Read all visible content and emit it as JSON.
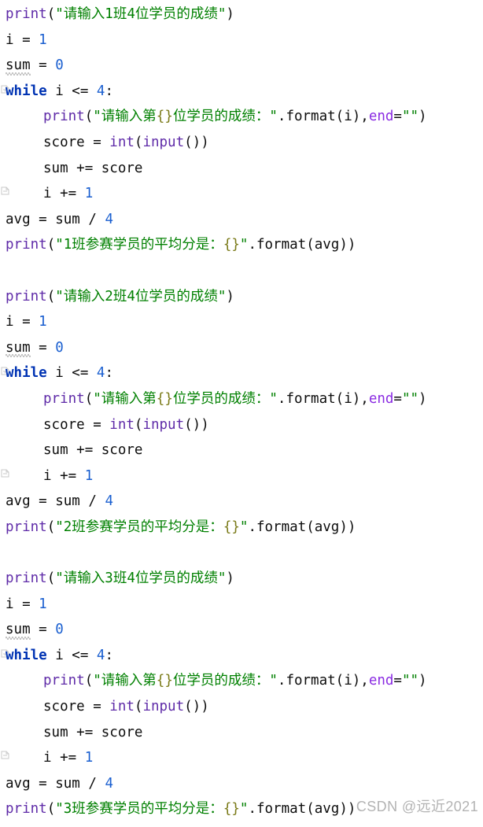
{
  "editor": {
    "language": "Python",
    "colors": {
      "background": "#ffffff",
      "text": "#0d0d0d",
      "keyword": "#0033b3",
      "builtin_function": "#5f2ba8",
      "number": "#1a5fd0",
      "string": "#008000",
      "format_brace": "#7a7a18",
      "keyword_argument": "#8a2be2",
      "warning_squiggle": "#b9b9b9",
      "fold_marker": "#c8c8c8"
    },
    "lines": [
      {
        "n": 1,
        "indent": 0,
        "tokens": [
          {
            "t": "print",
            "c": "fn"
          },
          {
            "t": "(",
            "c": "punct"
          },
          {
            "t": "\"请输入",
            "c": "str"
          },
          {
            "t": "1班4位学员的成绩\"",
            "c": "str"
          },
          {
            "t": ")",
            "c": "punct"
          }
        ]
      },
      {
        "n": 2,
        "indent": 0,
        "tokens": [
          {
            "t": "i ",
            "c": "plain"
          },
          {
            "t": "= ",
            "c": "punct"
          },
          {
            "t": "1",
            "c": "num"
          }
        ]
      },
      {
        "n": 3,
        "indent": 0,
        "warn": "sum",
        "tokens": [
          {
            "t": "sum",
            "c": "warn"
          },
          {
            "t": " = ",
            "c": "punct"
          },
          {
            "t": "0",
            "c": "num"
          }
        ]
      },
      {
        "n": 4,
        "indent": 0,
        "fold": "start",
        "tokens": [
          {
            "t": "while",
            "c": "kw"
          },
          {
            "t": " i ",
            "c": "plain"
          },
          {
            "t": "<=",
            "c": "punct"
          },
          {
            "t": " ",
            "c": "plain"
          },
          {
            "t": "4",
            "c": "num"
          },
          {
            "t": ":",
            "c": "punct"
          }
        ]
      },
      {
        "n": 5,
        "indent": 1,
        "tokens": [
          {
            "t": "print",
            "c": "fn"
          },
          {
            "t": "(",
            "c": "punct"
          },
          {
            "t": "\"请输入第",
            "c": "str"
          },
          {
            "t": "{}",
            "c": "brace"
          },
          {
            "t": "位学员的成绩：\"",
            "c": "str"
          },
          {
            "t": ".format(i)",
            "c": "plain"
          },
          {
            "t": ",",
            "c": "punct"
          },
          {
            "t": "end",
            "c": "kwarg"
          },
          {
            "t": "=",
            "c": "punct"
          },
          {
            "t": "\"\"",
            "c": "str"
          },
          {
            "t": ")",
            "c": "punct"
          }
        ]
      },
      {
        "n": 6,
        "indent": 1,
        "tokens": [
          {
            "t": "score ",
            "c": "plain"
          },
          {
            "t": "= ",
            "c": "punct"
          },
          {
            "t": "int",
            "c": "fn"
          },
          {
            "t": "(",
            "c": "punct"
          },
          {
            "t": "input",
            "c": "fn"
          },
          {
            "t": "())",
            "c": "punct"
          }
        ]
      },
      {
        "n": 7,
        "indent": 1,
        "tokens": [
          {
            "t": "sum ",
            "c": "plain"
          },
          {
            "t": "+= ",
            "c": "punct"
          },
          {
            "t": "score",
            "c": "plain"
          }
        ]
      },
      {
        "n": 8,
        "indent": 1,
        "fold": "end",
        "tokens": [
          {
            "t": "i ",
            "c": "plain"
          },
          {
            "t": "+= ",
            "c": "punct"
          },
          {
            "t": "1",
            "c": "num"
          }
        ]
      },
      {
        "n": 9,
        "indent": 0,
        "tokens": [
          {
            "t": "avg ",
            "c": "plain"
          },
          {
            "t": "= ",
            "c": "punct"
          },
          {
            "t": "sum ",
            "c": "plain"
          },
          {
            "t": "/ ",
            "c": "punct"
          },
          {
            "t": "4",
            "c": "num"
          }
        ]
      },
      {
        "n": 10,
        "indent": 0,
        "tokens": [
          {
            "t": "print",
            "c": "fn"
          },
          {
            "t": "(",
            "c": "punct"
          },
          {
            "t": "\"1班参赛学员的平均分是：",
            "c": "str"
          },
          {
            "t": "{}",
            "c": "brace"
          },
          {
            "t": "\"",
            "c": "str"
          },
          {
            "t": ".format(avg)",
            "c": "plain"
          },
          {
            "t": ")",
            "c": "punct"
          }
        ]
      },
      {
        "n": 11,
        "indent": 0,
        "blank": true,
        "tokens": []
      },
      {
        "n": 12,
        "indent": 0,
        "tokens": [
          {
            "t": "print",
            "c": "fn"
          },
          {
            "t": "(",
            "c": "punct"
          },
          {
            "t": "\"请输入",
            "c": "str"
          },
          {
            "t": "2班4位学员的成绩\"",
            "c": "str"
          },
          {
            "t": ")",
            "c": "punct"
          }
        ]
      },
      {
        "n": 13,
        "indent": 0,
        "tokens": [
          {
            "t": "i ",
            "c": "plain"
          },
          {
            "t": "= ",
            "c": "punct"
          },
          {
            "t": "1",
            "c": "num"
          }
        ]
      },
      {
        "n": 14,
        "indent": 0,
        "warn": "sum",
        "tokens": [
          {
            "t": "sum",
            "c": "warn"
          },
          {
            "t": " = ",
            "c": "punct"
          },
          {
            "t": "0",
            "c": "num"
          }
        ]
      },
      {
        "n": 15,
        "indent": 0,
        "fold": "start",
        "tokens": [
          {
            "t": "while",
            "c": "kw"
          },
          {
            "t": " i ",
            "c": "plain"
          },
          {
            "t": "<=",
            "c": "punct"
          },
          {
            "t": " ",
            "c": "plain"
          },
          {
            "t": "4",
            "c": "num"
          },
          {
            "t": ":",
            "c": "punct"
          }
        ]
      },
      {
        "n": 16,
        "indent": 1,
        "tokens": [
          {
            "t": "print",
            "c": "fn"
          },
          {
            "t": "(",
            "c": "punct"
          },
          {
            "t": "\"请输入第",
            "c": "str"
          },
          {
            "t": "{}",
            "c": "brace"
          },
          {
            "t": "位学员的成绩：\"",
            "c": "str"
          },
          {
            "t": ".format(i)",
            "c": "plain"
          },
          {
            "t": ",",
            "c": "punct"
          },
          {
            "t": "end",
            "c": "kwarg"
          },
          {
            "t": "=",
            "c": "punct"
          },
          {
            "t": "\"\"",
            "c": "str"
          },
          {
            "t": ")",
            "c": "punct"
          }
        ]
      },
      {
        "n": 17,
        "indent": 1,
        "tokens": [
          {
            "t": "score ",
            "c": "plain"
          },
          {
            "t": "= ",
            "c": "punct"
          },
          {
            "t": "int",
            "c": "fn"
          },
          {
            "t": "(",
            "c": "punct"
          },
          {
            "t": "input",
            "c": "fn"
          },
          {
            "t": "())",
            "c": "punct"
          }
        ]
      },
      {
        "n": 18,
        "indent": 1,
        "tokens": [
          {
            "t": "sum ",
            "c": "plain"
          },
          {
            "t": "+= ",
            "c": "punct"
          },
          {
            "t": "score",
            "c": "plain"
          }
        ]
      },
      {
        "n": 19,
        "indent": 1,
        "fold": "end",
        "tokens": [
          {
            "t": "i ",
            "c": "plain"
          },
          {
            "t": "+= ",
            "c": "punct"
          },
          {
            "t": "1",
            "c": "num"
          }
        ]
      },
      {
        "n": 20,
        "indent": 0,
        "tokens": [
          {
            "t": "avg ",
            "c": "plain"
          },
          {
            "t": "= ",
            "c": "punct"
          },
          {
            "t": "sum ",
            "c": "plain"
          },
          {
            "t": "/ ",
            "c": "punct"
          },
          {
            "t": "4",
            "c": "num"
          }
        ]
      },
      {
        "n": 21,
        "indent": 0,
        "tokens": [
          {
            "t": "print",
            "c": "fn"
          },
          {
            "t": "(",
            "c": "punct"
          },
          {
            "t": "\"2班参赛学员的平均分是：",
            "c": "str"
          },
          {
            "t": "{}",
            "c": "brace"
          },
          {
            "t": "\"",
            "c": "str"
          },
          {
            "t": ".format(avg)",
            "c": "plain"
          },
          {
            "t": ")",
            "c": "punct"
          }
        ]
      },
      {
        "n": 22,
        "indent": 0,
        "blank": true,
        "tokens": []
      },
      {
        "n": 23,
        "indent": 0,
        "tokens": [
          {
            "t": "print",
            "c": "fn"
          },
          {
            "t": "(",
            "c": "punct"
          },
          {
            "t": "\"请输入",
            "c": "str"
          },
          {
            "t": "3班4位学员的成绩\"",
            "c": "str"
          },
          {
            "t": ")",
            "c": "punct"
          }
        ]
      },
      {
        "n": 24,
        "indent": 0,
        "tokens": [
          {
            "t": "i ",
            "c": "plain"
          },
          {
            "t": "= ",
            "c": "punct"
          },
          {
            "t": "1",
            "c": "num"
          }
        ]
      },
      {
        "n": 25,
        "indent": 0,
        "warn": "sum",
        "tokens": [
          {
            "t": "sum",
            "c": "warn"
          },
          {
            "t": " = ",
            "c": "punct"
          },
          {
            "t": "0",
            "c": "num"
          }
        ]
      },
      {
        "n": 26,
        "indent": 0,
        "fold": "start",
        "tokens": [
          {
            "t": "while",
            "c": "kw"
          },
          {
            "t": " i ",
            "c": "plain"
          },
          {
            "t": "<=",
            "c": "punct"
          },
          {
            "t": " ",
            "c": "plain"
          },
          {
            "t": "4",
            "c": "num"
          },
          {
            "t": ":",
            "c": "punct"
          }
        ]
      },
      {
        "n": 27,
        "indent": 1,
        "tokens": [
          {
            "t": "print",
            "c": "fn"
          },
          {
            "t": "(",
            "c": "punct"
          },
          {
            "t": "\"请输入第",
            "c": "str"
          },
          {
            "t": "{}",
            "c": "brace"
          },
          {
            "t": "位学员的成绩：\"",
            "c": "str"
          },
          {
            "t": ".format(i)",
            "c": "plain"
          },
          {
            "t": ",",
            "c": "punct"
          },
          {
            "t": "end",
            "c": "kwarg"
          },
          {
            "t": "=",
            "c": "punct"
          },
          {
            "t": "\"\"",
            "c": "str"
          },
          {
            "t": ")",
            "c": "punct"
          }
        ]
      },
      {
        "n": 28,
        "indent": 1,
        "tokens": [
          {
            "t": "score ",
            "c": "plain"
          },
          {
            "t": "= ",
            "c": "punct"
          },
          {
            "t": "int",
            "c": "fn"
          },
          {
            "t": "(",
            "c": "punct"
          },
          {
            "t": "input",
            "c": "fn"
          },
          {
            "t": "())",
            "c": "punct"
          }
        ]
      },
      {
        "n": 29,
        "indent": 1,
        "tokens": [
          {
            "t": "sum ",
            "c": "plain"
          },
          {
            "t": "+= ",
            "c": "punct"
          },
          {
            "t": "score",
            "c": "plain"
          }
        ]
      },
      {
        "n": 30,
        "indent": 1,
        "fold": "end",
        "tokens": [
          {
            "t": "i ",
            "c": "plain"
          },
          {
            "t": "+= ",
            "c": "punct"
          },
          {
            "t": "1",
            "c": "num"
          }
        ]
      },
      {
        "n": 31,
        "indent": 0,
        "tokens": [
          {
            "t": "avg ",
            "c": "plain"
          },
          {
            "t": "= ",
            "c": "punct"
          },
          {
            "t": "sum ",
            "c": "plain"
          },
          {
            "t": "/ ",
            "c": "punct"
          },
          {
            "t": "4",
            "c": "num"
          }
        ]
      },
      {
        "n": 32,
        "indent": 0,
        "clipped": true,
        "tokens": [
          {
            "t": "print",
            "c": "fn"
          },
          {
            "t": "(",
            "c": "punct"
          },
          {
            "t": "\"3班参赛学员的平均分是：",
            "c": "str"
          },
          {
            "t": "{}",
            "c": "brace"
          },
          {
            "t": "\"",
            "c": "str"
          },
          {
            "t": ".format(avg)",
            "c": "plain"
          },
          {
            "t": ")",
            "c": "punct"
          }
        ]
      }
    ]
  },
  "watermark": {
    "text": "CSDN @远近2021"
  }
}
